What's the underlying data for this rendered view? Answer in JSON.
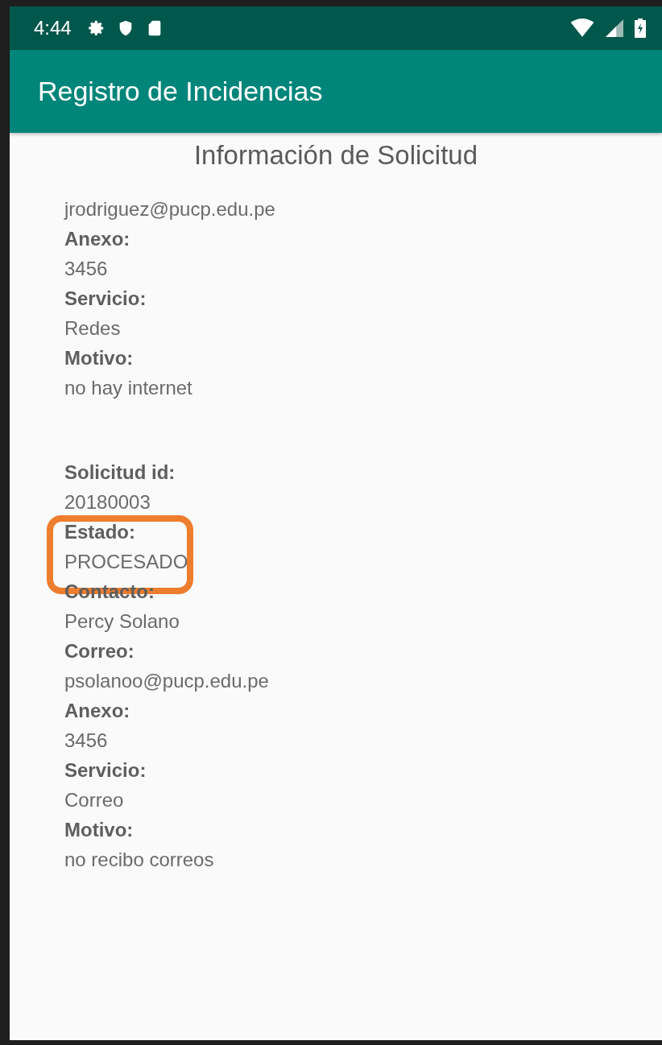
{
  "status_bar": {
    "time": "4:44"
  },
  "app_bar": {
    "title": "Registro de Incidencias"
  },
  "heading": "Información de Solicitud",
  "sections": [
    {
      "lines": [
        {
          "kind": "value",
          "text": "jrodriguez@pucp.edu.pe",
          "highlighted": false
        },
        {
          "kind": "label",
          "text": "Anexo:",
          "highlighted": false
        },
        {
          "kind": "value",
          "text": "3456",
          "highlighted": false
        },
        {
          "kind": "label",
          "text": "Servicio:",
          "highlighted": false
        },
        {
          "kind": "value",
          "text": "Redes",
          "highlighted": false
        },
        {
          "kind": "label",
          "text": "Motivo:",
          "highlighted": false
        },
        {
          "kind": "value",
          "text": "no hay internet",
          "highlighted": false
        }
      ]
    },
    {
      "lines": [
        {
          "kind": "label",
          "text": "Solicitud id:",
          "highlighted": false
        },
        {
          "kind": "value",
          "text": "20180003",
          "highlighted": false
        },
        {
          "kind": "label",
          "text": "Estado:",
          "highlighted": true
        },
        {
          "kind": "value",
          "text": "PROCESADO",
          "highlighted": true
        },
        {
          "kind": "label",
          "text": "Contacto:",
          "highlighted": false
        },
        {
          "kind": "value",
          "text": "Percy Solano",
          "highlighted": false
        },
        {
          "kind": "label",
          "text": "Correo:",
          "highlighted": false
        },
        {
          "kind": "value",
          "text": "psolanoo@pucp.edu.pe",
          "highlighted": false
        },
        {
          "kind": "label",
          "text": "Anexo:",
          "highlighted": false
        },
        {
          "kind": "value",
          "text": "3456",
          "highlighted": false
        },
        {
          "kind": "label",
          "text": "Servicio:",
          "highlighted": false
        },
        {
          "kind": "value",
          "text": "Correo",
          "highlighted": false
        },
        {
          "kind": "label",
          "text": "Motivo:",
          "highlighted": false
        },
        {
          "kind": "value",
          "text": "no recibo correos",
          "highlighted": false
        }
      ]
    }
  ]
}
